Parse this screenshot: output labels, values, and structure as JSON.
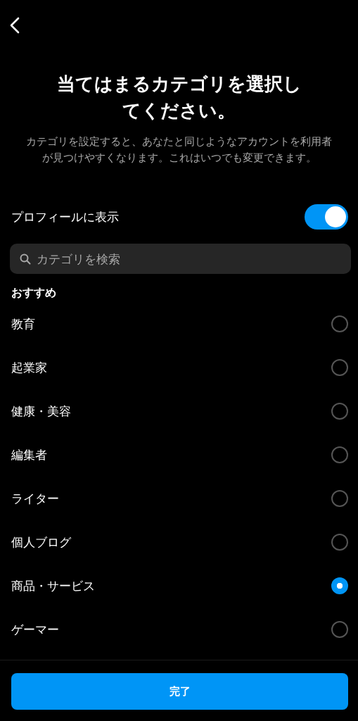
{
  "title": "当てはまるカテゴリを選択してください。",
  "description": "カテゴリを設定すると、あなたと同じようなアカウントを利用者が見つけやすくなります。これはいつでも変更できます。",
  "profile_toggle": {
    "label": "プロフィールに表示",
    "on": true
  },
  "search": {
    "placeholder": "カテゴリを検索"
  },
  "section": "おすすめ",
  "categories": [
    {
      "label": "教育",
      "selected": false
    },
    {
      "label": "起業家",
      "selected": false
    },
    {
      "label": "健康・美容",
      "selected": false
    },
    {
      "label": "編集者",
      "selected": false
    },
    {
      "label": "ライター",
      "selected": false
    },
    {
      "label": "個人ブログ",
      "selected": false
    },
    {
      "label": "商品・サービス",
      "selected": true
    },
    {
      "label": "ゲーマー",
      "selected": false
    }
  ],
  "done_button": "完了"
}
